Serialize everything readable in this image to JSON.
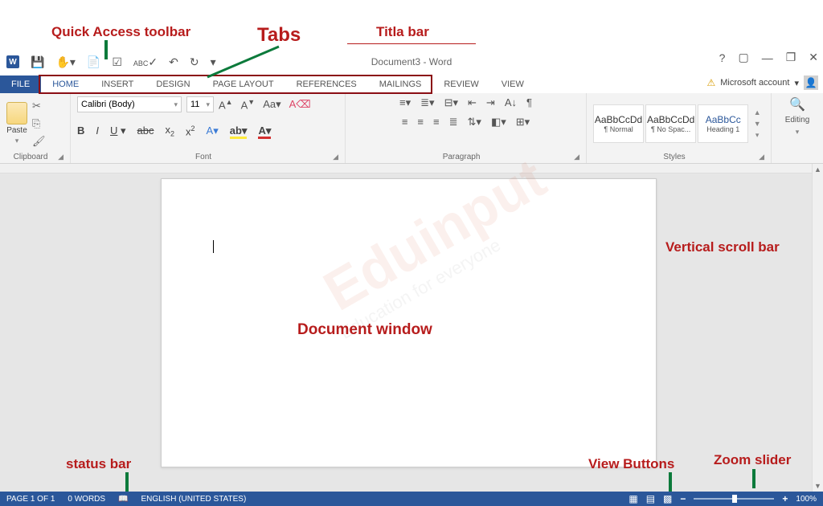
{
  "annotations": {
    "quick_access": "Quick Access toolbar",
    "tabs": "Tabs",
    "title_bar": "Titla bar",
    "document_window": "Document window",
    "vertical_scroll": "Vertical scroll bar",
    "status_bar": "status bar",
    "view_buttons": "View Buttons",
    "zoom_slider": "Zoom slider"
  },
  "titlebar": {
    "app_icon": "W",
    "title": "Document3 - Word"
  },
  "window_controls": {
    "help": "?",
    "ribbon_opts": "▢",
    "minimize": "—",
    "restore": "❐",
    "close": "✕"
  },
  "account": {
    "label": "Microsoft account",
    "dd": "▾"
  },
  "tabs_row": {
    "file": "FILE",
    "home": "HOME",
    "insert": "INSERT",
    "design": "DESIGN",
    "page_layout": "PAGE LAYOUT",
    "references": "REFERENCES",
    "mailings": "MAILINGS",
    "review": "REVIEW",
    "view": "VIEW"
  },
  "ribbon": {
    "clipboard": {
      "label": "Clipboard",
      "paste": "Paste"
    },
    "font": {
      "label": "Font",
      "name": "Calibri (Body)",
      "size": "11"
    },
    "paragraph": {
      "label": "Paragraph"
    },
    "styles": {
      "label": "Styles",
      "s1_preview": "AaBbCcDd",
      "s1_name": "¶ Normal",
      "s2_preview": "AaBbCcDd",
      "s2_name": "¶ No Spac...",
      "s3_preview": "AaBbCc",
      "s3_name": "Heading 1"
    },
    "editing": {
      "label": "Editing"
    }
  },
  "statusbar": {
    "page": "PAGE 1 OF 1",
    "words": "0 WORDS",
    "language": "ENGLISH (UNITED STATES)",
    "zoom": "100%"
  },
  "watermark": {
    "main": "Eduinput",
    "sub": "Education for everyone"
  }
}
